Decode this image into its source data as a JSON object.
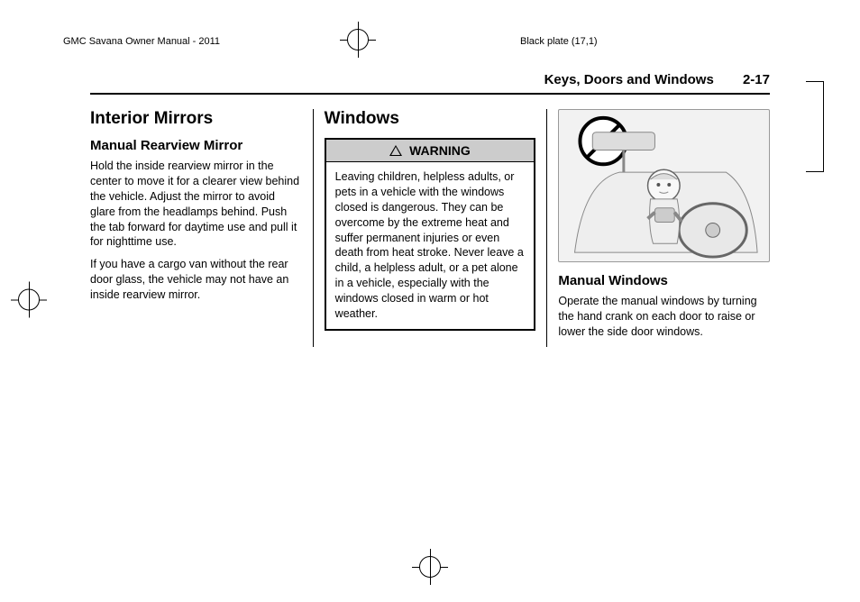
{
  "print": {
    "doc_title": "GMC Savana Owner Manual - 2011",
    "plate": "Black plate (17,1)"
  },
  "header": {
    "section": "Keys, Doors and Windows",
    "page": "2-17"
  },
  "col1": {
    "h1": "Interior Mirrors",
    "h2": "Manual Rearview Mirror",
    "p1": "Hold the inside rearview mirror in the center to move it for a clearer view behind the vehicle. Adjust the mirror to avoid glare from the headlamps behind. Push the tab forward for daytime use and pull it for nighttime use.",
    "p2": "If you have a cargo van without the rear door glass, the vehicle may not have an inside rearview mirror."
  },
  "col2": {
    "h1": "Windows",
    "warning_label": "WARNING",
    "warning_body": "Leaving children, helpless adults, or pets in a vehicle with the windows closed is dangerous. They can be overcome by the extreme heat and suffer permanent injuries or even death from heat stroke. Never leave a child, a helpless adult, or a pet alone in a vehicle, especially with the windows closed in warm or hot weather."
  },
  "col3": {
    "h2": "Manual Windows",
    "p1": "Operate the manual windows by turning the hand crank on each door to raise or lower the side door windows."
  }
}
